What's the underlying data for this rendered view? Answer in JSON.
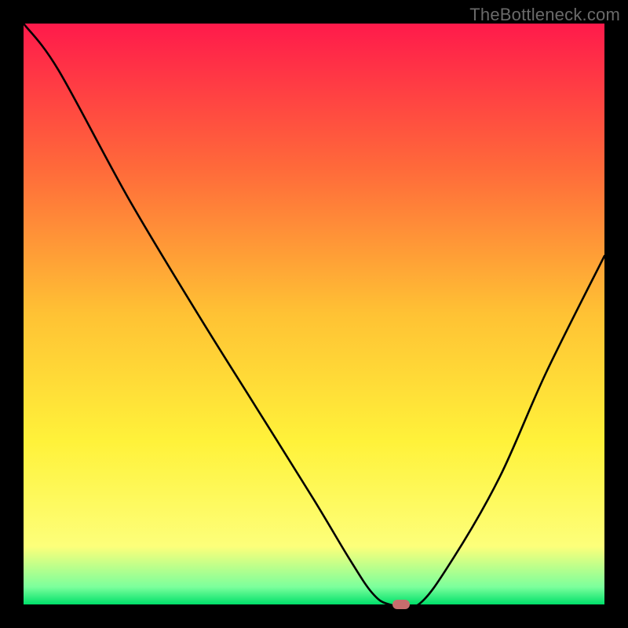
{
  "watermark": "TheBottleneck.com",
  "chart_data": {
    "type": "line",
    "title": "",
    "xlabel": "",
    "ylabel": "",
    "xlim": [
      0,
      100
    ],
    "ylim": [
      0,
      100
    ],
    "grid": false,
    "legend": false,
    "background_gradient": {
      "stops": [
        {
          "offset": 0.0,
          "color": "#ff1a4b"
        },
        {
          "offset": 0.25,
          "color": "#ff6a3a"
        },
        {
          "offset": 0.5,
          "color": "#ffc234"
        },
        {
          "offset": 0.72,
          "color": "#fff23a"
        },
        {
          "offset": 0.9,
          "color": "#fdff7a"
        },
        {
          "offset": 0.97,
          "color": "#7bff9c"
        },
        {
          "offset": 1.0,
          "color": "#00e06a"
        }
      ]
    },
    "series": [
      {
        "name": "bottleneck-curve",
        "x": [
          0,
          6,
          18,
          30,
          40,
          50,
          56,
          60,
          63,
          68,
          74,
          82,
          90,
          100
        ],
        "y": [
          100,
          92,
          70,
          50,
          34,
          18,
          8,
          2,
          0,
          0,
          8,
          22,
          40,
          60
        ]
      }
    ],
    "annotations": [
      {
        "name": "optimal-marker",
        "shape": "rounded-rect",
        "x": 65,
        "y": 0,
        "color": "#c76d6d"
      }
    ]
  }
}
